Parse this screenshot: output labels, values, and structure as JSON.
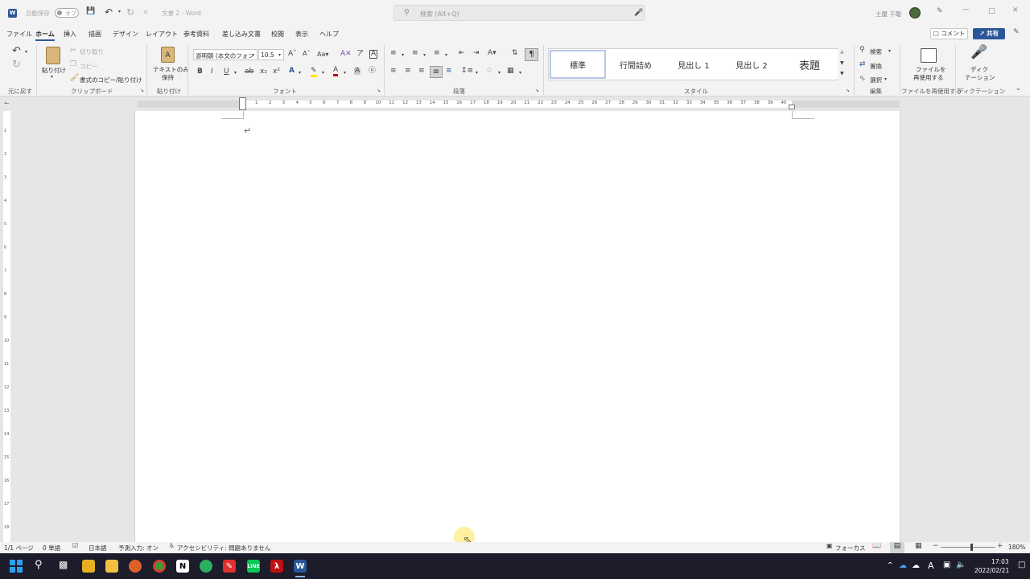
{
  "titlebar": {
    "autosave_label": "自動保存",
    "autosave_state": "オフ",
    "doc_title": "文書 2  -  Word",
    "search_placeholder": "検索 (Alt+Q)",
    "user_name": "土屋 千聡"
  },
  "menu": {
    "items": [
      "ファイル",
      "ホーム",
      "挿入",
      "描画",
      "デザイン",
      "レイアウト",
      "参考資料",
      "差し込み文書",
      "校閲",
      "表示",
      "ヘルプ"
    ],
    "active": "ホーム",
    "comment_label": "コメント",
    "share_label": "共有"
  },
  "ribbon": {
    "undo_group": "元に戻す",
    "clipboard": {
      "paste": "貼り付け",
      "cut": "切り取り",
      "copy": "コピー",
      "format_painter": "書式のコピー/貼り付け",
      "group": "クリップボード"
    },
    "paste_text": {
      "label1": "テキストのみ",
      "label2": "保持",
      "group": "貼り付け"
    },
    "font": {
      "name": "游明朝 (本文のフォン",
      "size": "10.5",
      "group": "フォント"
    },
    "paragraph": {
      "group": "段落"
    },
    "styles": {
      "items": [
        "標準",
        "行間詰め",
        "見出し 1",
        "見出し 2",
        "表題"
      ],
      "group": "スタイル"
    },
    "editing": {
      "find": "検索",
      "replace": "置換",
      "select": "選択",
      "group": "編集"
    },
    "reuse": {
      "label1": "ファイルを",
      "label2": "再使用する",
      "group": "ファイルを再使用する"
    },
    "dictate": {
      "label1": "ディク",
      "label2": "テーション",
      "group": "ディクテーション"
    }
  },
  "ruler": {
    "numbers": [
      "1",
      "2",
      "3",
      "4",
      "5",
      "6",
      "7",
      "8",
      "9",
      "10",
      "11",
      "12",
      "13",
      "14",
      "15",
      "16",
      "17",
      "18",
      "19",
      "20",
      "21",
      "22",
      "23",
      "24",
      "25",
      "26",
      "27",
      "28",
      "29",
      "30",
      "31",
      "32",
      "33",
      "34",
      "35",
      "36",
      "37",
      "38",
      "39",
      "40"
    ]
  },
  "status": {
    "page": "1/1 ページ",
    "words": "0 単語",
    "lang": "日本語",
    "predict": "予測入力: オン",
    "access": "アクセシビリティ: 問題ありません",
    "focus": "フォーカス",
    "zoom": "180%"
  },
  "taskbar": {
    "time": "17:03",
    "date": "2022/02/21"
  },
  "colors": {
    "accent": "#2b579a",
    "taskbar": "#1c1c2a"
  }
}
